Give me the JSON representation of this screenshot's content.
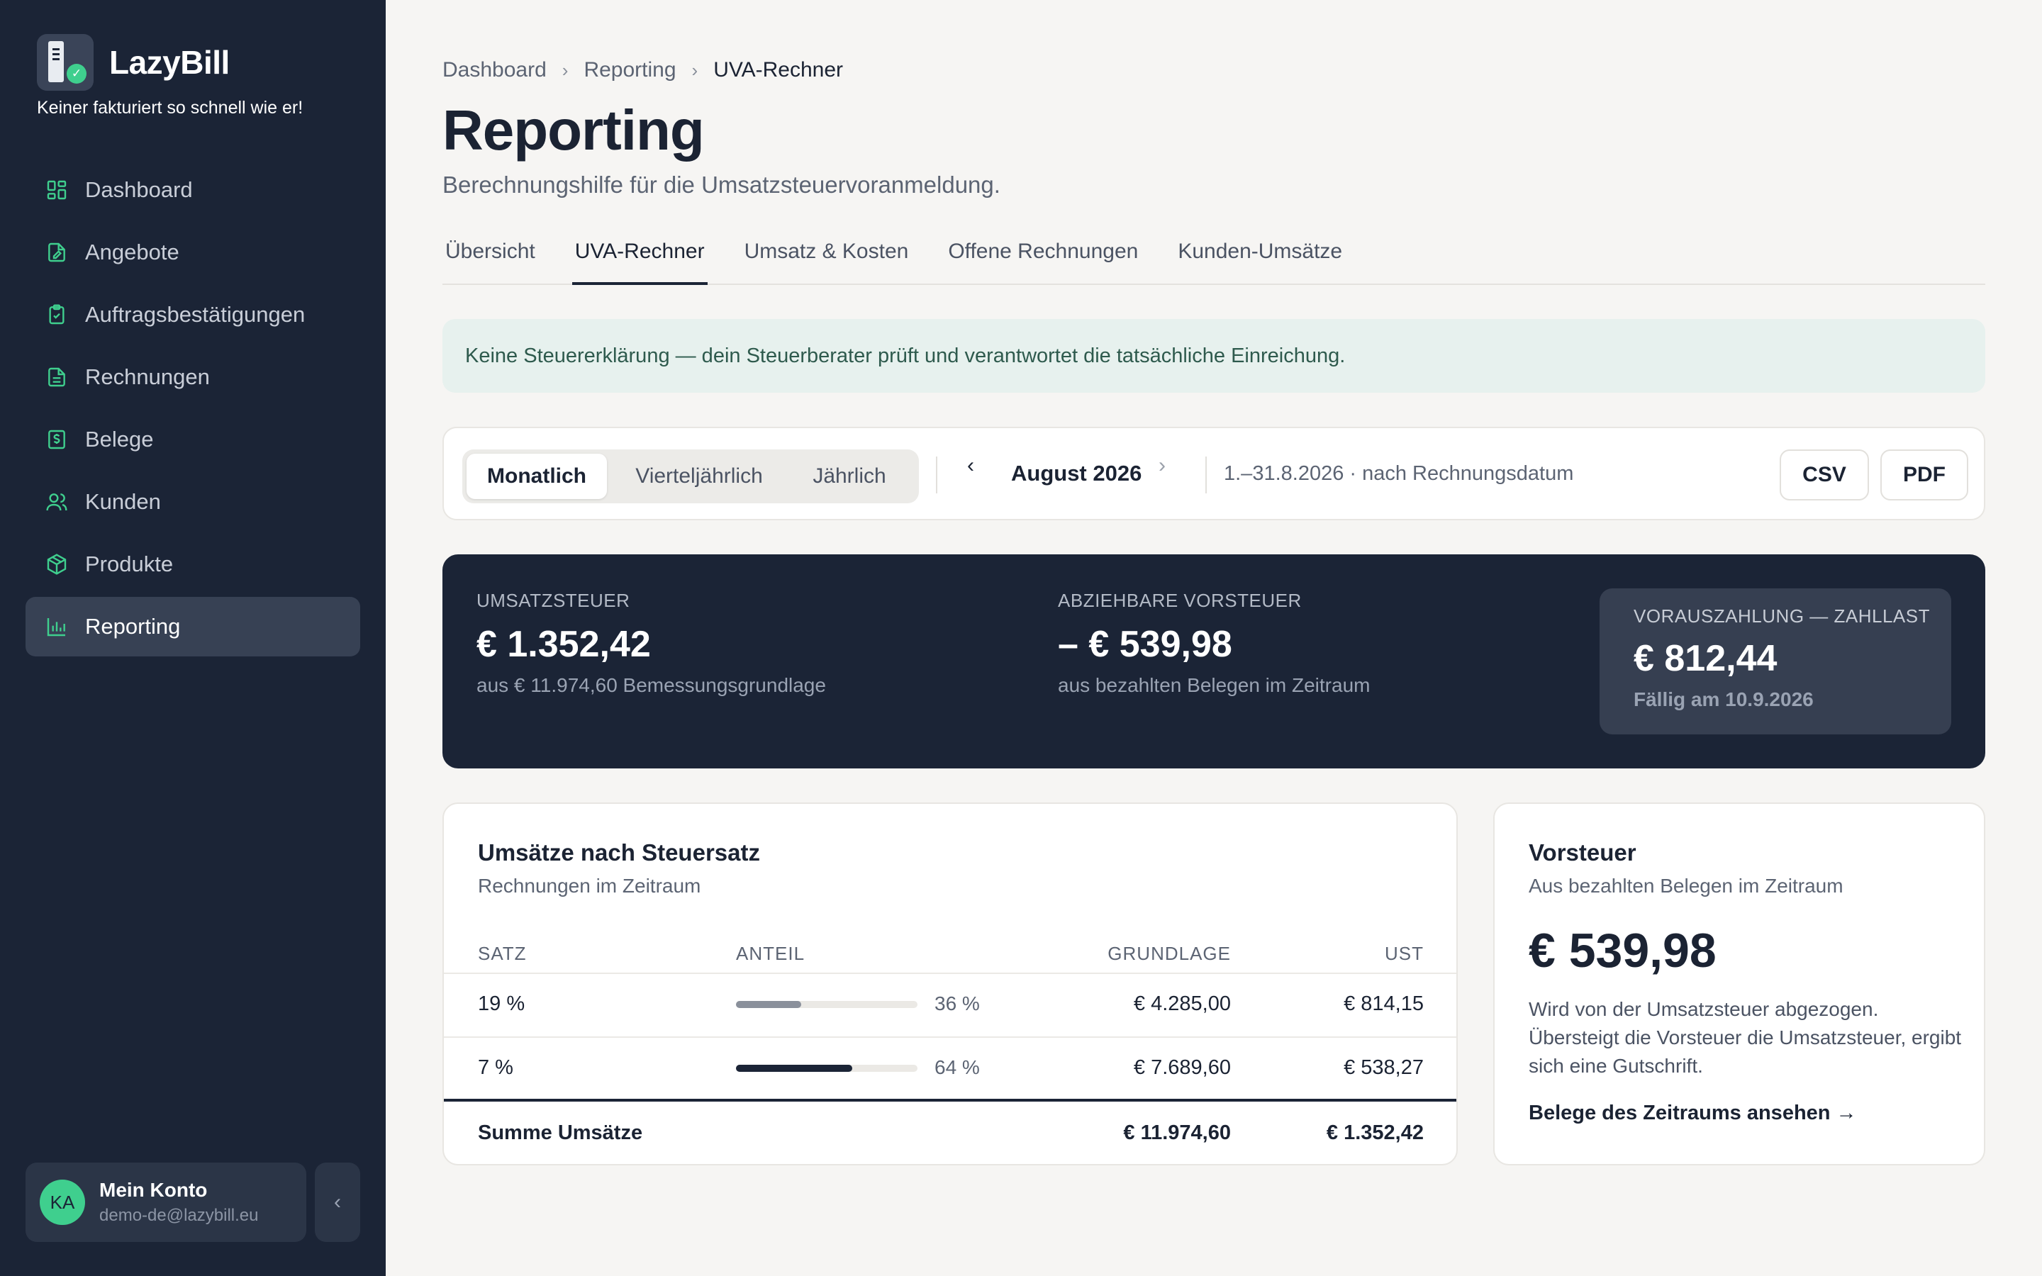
{
  "app": {
    "name": "LazyBill",
    "tagline": "Keiner fakturiert so schnell wie er!"
  },
  "sidebar": {
    "items": [
      {
        "label": "Dashboard",
        "icon": "dashboard-icon"
      },
      {
        "label": "Angebote",
        "icon": "offer-icon"
      },
      {
        "label": "Auftragsbestätigungen",
        "icon": "clipboard-check-icon"
      },
      {
        "label": "Rechnungen",
        "icon": "invoice-icon"
      },
      {
        "label": "Belege",
        "icon": "receipt-icon"
      },
      {
        "label": "Kunden",
        "icon": "customers-icon"
      },
      {
        "label": "Produkte",
        "icon": "package-icon"
      },
      {
        "label": "Reporting",
        "icon": "bar-chart-icon",
        "active": true
      }
    ],
    "account": {
      "initials": "KA",
      "name": "Mein Konto",
      "email": "demo-de@lazybill.eu"
    },
    "collapse_glyph": "‹"
  },
  "breadcrumb": [
    "Dashboard",
    "Reporting",
    "UVA-Rechner"
  ],
  "breadcrumb_sep": "›",
  "page": {
    "title": "Reporting",
    "subtitle": "Berechnungshilfe für die Umsatzsteuervoranmeldung."
  },
  "tabs": [
    {
      "label": "Übersicht"
    },
    {
      "label": "UVA-Rechner",
      "active": true
    },
    {
      "label": "Umsatz & Kosten"
    },
    {
      "label": "Offene Rechnungen"
    },
    {
      "label": "Kunden-Umsätze"
    }
  ],
  "notice": "Keine Steuererklärung — dein Steuerberater prüft und verantwortet die tatsächliche Einreichung.",
  "toolbar": {
    "periods": [
      "Monatlich",
      "Vierteljährlich",
      "Jährlich"
    ],
    "active_period": "Monatlich",
    "prev_glyph": "‹",
    "next_glyph": "›",
    "period_label": "August 2026",
    "range_text": "1.–31.8.2026 · nach Rechnungsdatum",
    "csv_label": "CSV",
    "pdf_label": "PDF"
  },
  "summary": {
    "ust": {
      "label": "UMSATZSTEUER",
      "value": "€ 1.352,42",
      "note": "aus € 11.974,60 Bemessungsgrundlage"
    },
    "vorsteuer": {
      "label": "ABZIEHBARE VORSTEUER",
      "value": "– € 539,98",
      "note": "aus bezahlten Belegen im Zeitraum"
    },
    "zahllast": {
      "label": "VORAUSZAHLUNG — ZAHLLAST",
      "value": "€ 812,44",
      "note": "Fällig am 10.9.2026"
    }
  },
  "umsaetze": {
    "title": "Umsätze nach Steuersatz",
    "subtitle": "Rechnungen im Zeitraum",
    "headers": {
      "satz": "SATZ",
      "anteil": "ANTEIL",
      "grundlage": "GRUNDLAGE",
      "ust": "UST"
    },
    "rows": [
      {
        "satz": "19 %",
        "share": 0.36,
        "pct": "36 %",
        "grundlage": "€ 4.285,00",
        "ust": "€ 814,15",
        "bar_color": "#8a909b"
      },
      {
        "satz": "7 %",
        "share": 0.64,
        "pct": "64 %",
        "grundlage": "€ 7.689,60",
        "ust": "€ 538,27",
        "bar_color": "#1b2436"
      }
    ],
    "total": {
      "label": "Summe Umsätze",
      "grundlage": "€ 11.974,60",
      "ust": "€ 1.352,42"
    }
  },
  "vorsteuer_card": {
    "title": "Vorsteuer",
    "subtitle": "Aus bezahlten Belegen im Zeitraum",
    "value": "€ 539,98",
    "description": "Wird von der Umsatzsteuer abgezogen. Übersteigt die Vorsteuer die Umsatzsteuer, ergibt sich eine Gutschrift.",
    "link": "Belege des Zeitraums ansehen →"
  },
  "colors": {
    "sidebar_bg": "#1b2436",
    "accent_green": "#3fcf8e",
    "page_bg": "#f6f5f3",
    "notice_bg": "#e7f1ee"
  }
}
